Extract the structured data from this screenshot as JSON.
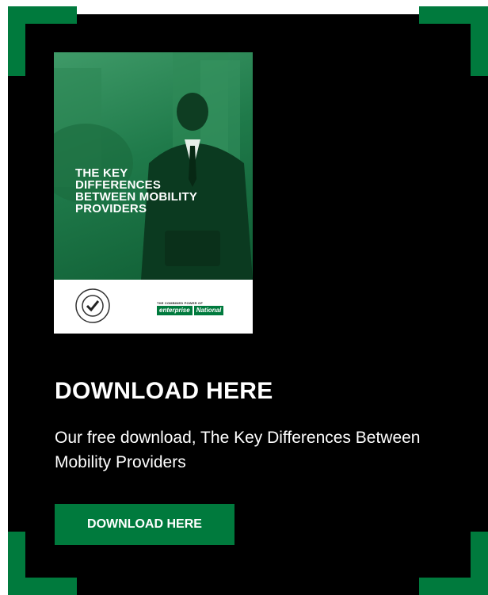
{
  "colors": {
    "brand_green": "#007a3d",
    "panel_bg": "#000000",
    "text": "#ffffff"
  },
  "cover": {
    "title": "THE KEY\nDIFFERENCES\nBETWEEN MOBILITY\nPROVIDERS",
    "badge_top_text": "COMPLETE CLEAN",
    "badge_bottom_text": "PLEDGE",
    "brand_tagline": "THE COMBINED POWER OF",
    "brand_enterprise": "enterprise",
    "brand_national": "National"
  },
  "heading": "DOWNLOAD HERE",
  "description": "Our free download, The Key Differences Between Mobility Providers",
  "cta_label": "DOWNLOAD HERE"
}
